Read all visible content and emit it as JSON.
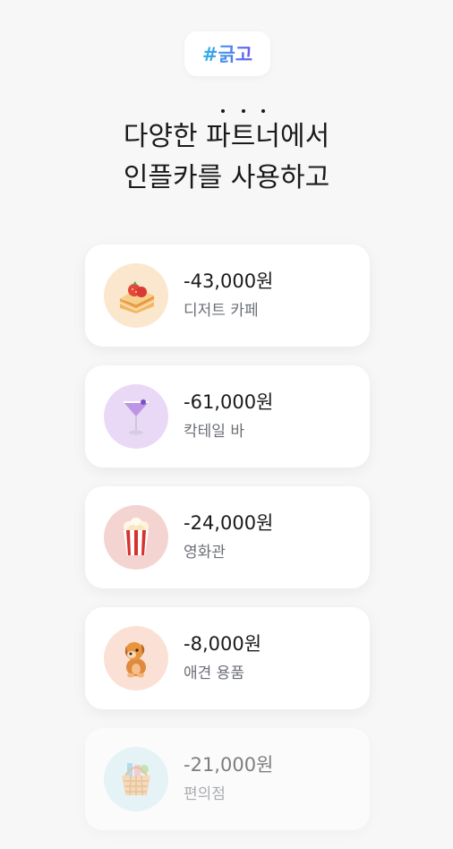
{
  "tag": "#긁고",
  "headline": {
    "line1_pre": "다양한 ",
    "line1_highlight": "파트너",
    "line1_post": "에서",
    "line2": "인플카를 사용하고"
  },
  "transactions": [
    {
      "amount": "-43,000원",
      "category": "디저트 카페",
      "icon": "cake-icon",
      "bg": "#fbe7cd"
    },
    {
      "amount": "-61,000원",
      "category": "칵테일 바",
      "icon": "cocktail-icon",
      "bg": "#ead8f7"
    },
    {
      "amount": "-24,000원",
      "category": "영화관",
      "icon": "popcorn-icon",
      "bg": "#f4d4d0"
    },
    {
      "amount": "-8,000원",
      "category": "애견 용품",
      "icon": "dog-icon",
      "bg": "#fbe1d5"
    },
    {
      "amount": "-21,000원",
      "category": "편의점",
      "icon": "basket-icon",
      "bg": "#d8f1f5"
    }
  ]
}
